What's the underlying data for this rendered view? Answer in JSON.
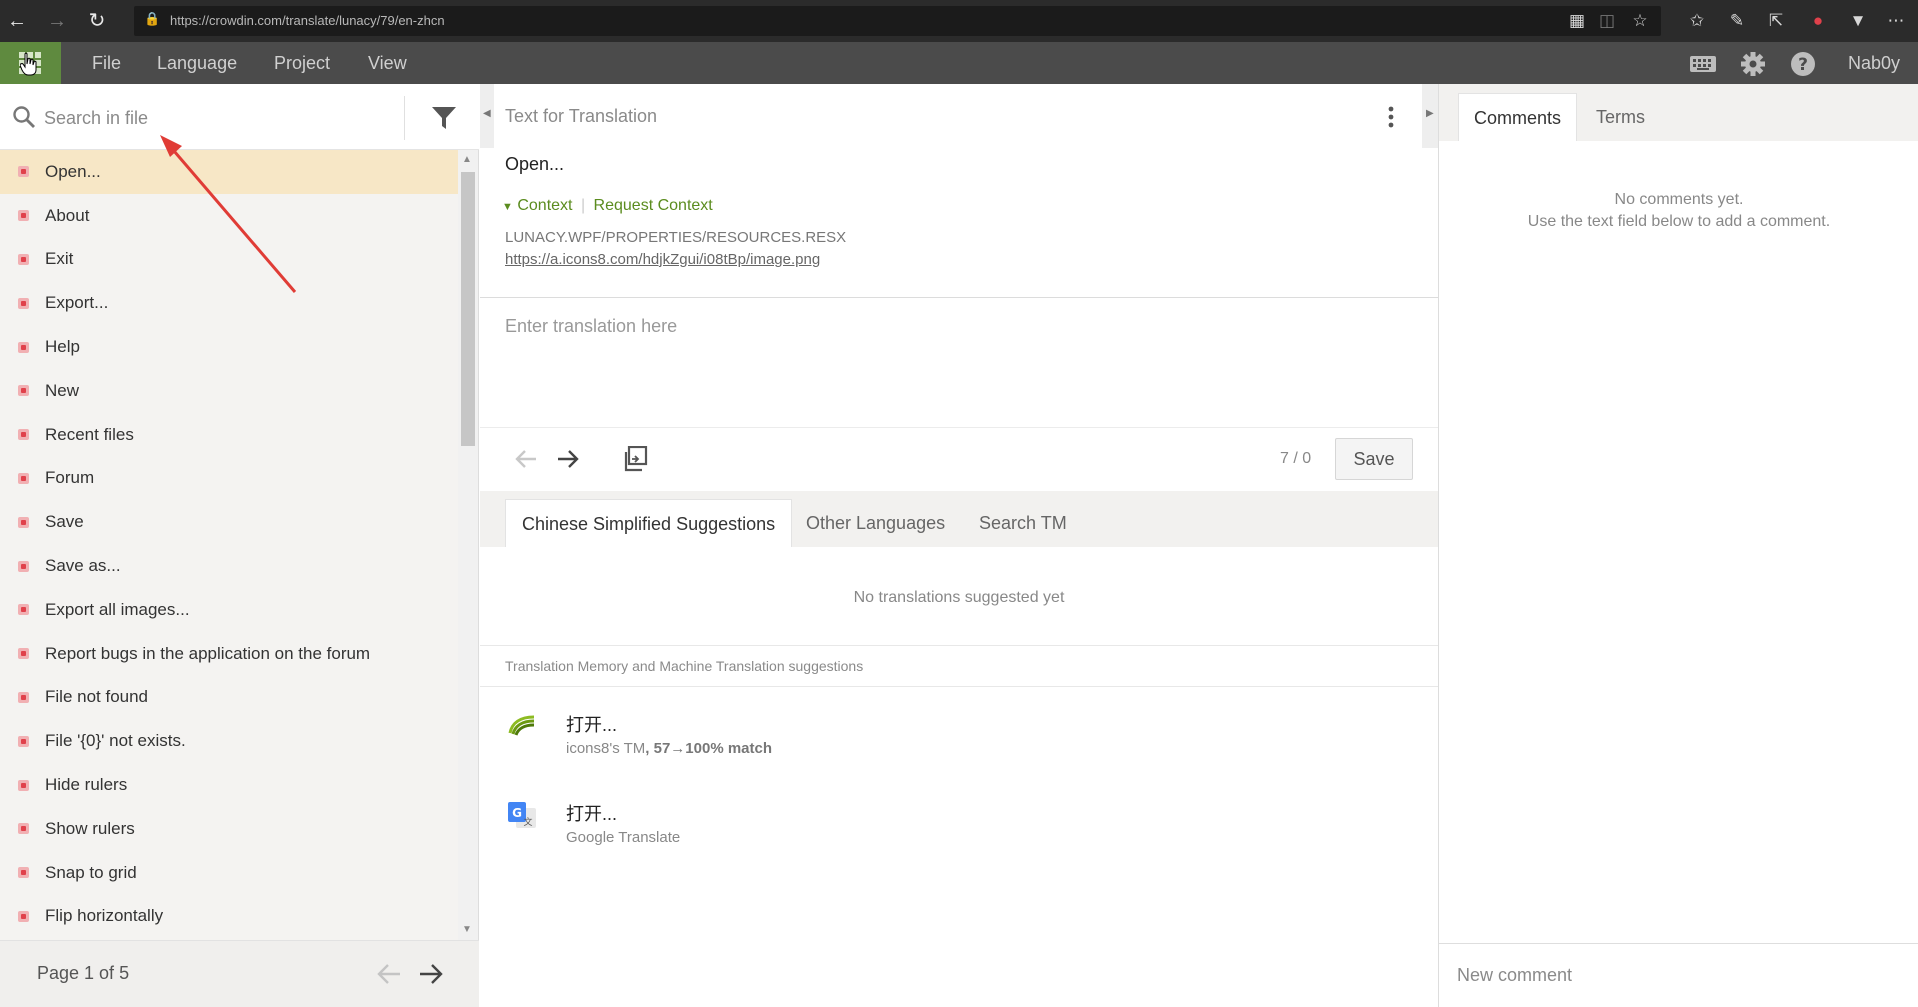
{
  "browser": {
    "url": "https://crowdin.com/translate/lunacy/79/en-zhcn"
  },
  "menu": {
    "items": [
      "File",
      "Language",
      "Project",
      "View"
    ],
    "user": "Nab0y"
  },
  "left": {
    "search_placeholder": "Search in file",
    "strings": [
      "Open...",
      "About",
      "Exit",
      "Export...",
      "Help",
      "New",
      "Recent files",
      "Forum",
      "Save",
      "Save as...",
      "Export all images...",
      "Report bugs in the application on the forum",
      "File not found",
      "File '{0}' not exists.",
      "Hide rulers",
      "Show rulers",
      "Snap to grid",
      "Flip horizontally"
    ],
    "active_index": 0,
    "page_label": "Page 1 of 5"
  },
  "center": {
    "section_title": "Text for Translation",
    "source_text": "Open...",
    "context_label": "Context",
    "request_context": "Request Context",
    "context_path": "LUNACY.WPF/PROPERTIES/RESOURCES.RESX",
    "context_link": "https://a.icons8.com/hdjkZgui/i08tBp/image.png",
    "translation_placeholder": "Enter translation here",
    "counter": "7 / 0",
    "save_label": "Save",
    "tabs": [
      "Chinese Simplified Suggestions",
      "Other Languages",
      "Search TM"
    ],
    "no_suggestions": "No translations suggested yet",
    "tm_header": "Translation Memory and Machine Translation suggestions",
    "tm": [
      {
        "text": "打开...",
        "source": "icons8's TM",
        "match": ", 57→100% match"
      },
      {
        "text": "打开...",
        "source": "Google Translate",
        "match": ""
      }
    ]
  },
  "right": {
    "tabs": [
      "Comments",
      "Terms"
    ],
    "no_comments_1": "No comments yet.",
    "no_comments_2": "Use the text field below to add a comment.",
    "comment_placeholder": "New comment"
  },
  "colors": {
    "accent_green": "#5b8c1f",
    "header_bg": "#4b4b4b",
    "logo_bg": "#5f8a3f",
    "untranslated_red": "#e0414b",
    "annotation_arrow": "#e03c36"
  }
}
